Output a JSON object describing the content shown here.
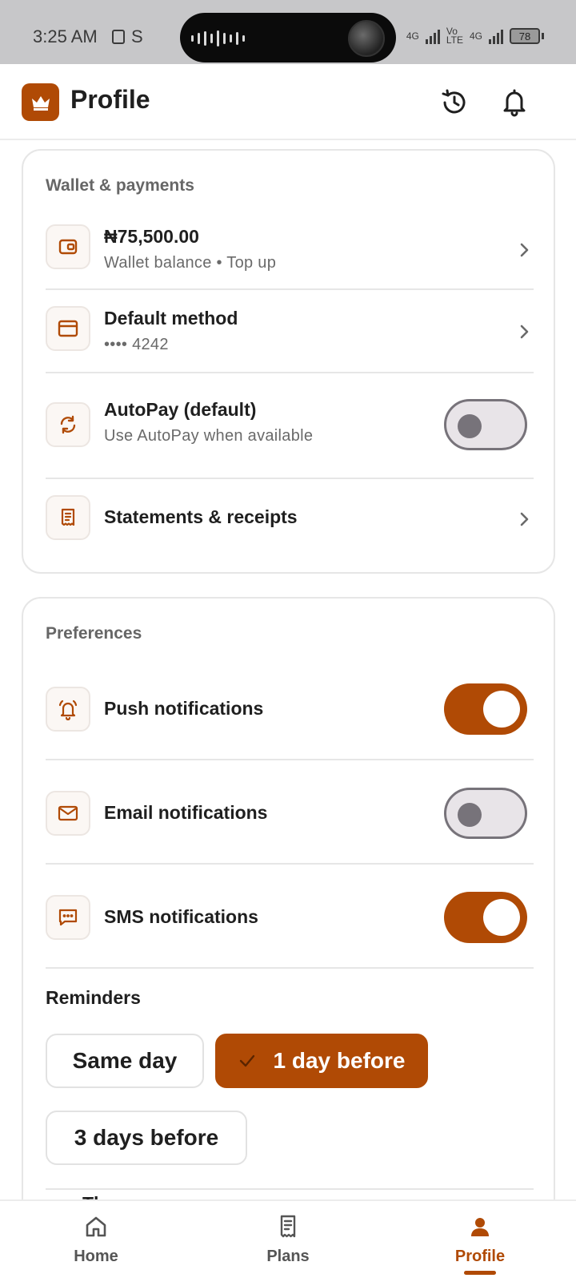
{
  "status_bar": {
    "time": "3:25 AM",
    "carrier_glyph": "S",
    "net1": "4G",
    "net2_top": "Vo",
    "net2_bottom": "LTE",
    "net3": "4G",
    "battery": "78"
  },
  "header": {
    "title": "Profile",
    "history_icon": "history-icon",
    "bell_icon": "bell-icon",
    "logo_icon": "crown-icon"
  },
  "wallet_card": {
    "title": "Wallet & payments",
    "balance": {
      "title": "₦75,500.00",
      "subtitle": "Wallet balance • Top up",
      "icon": "wallet-icon"
    },
    "default_method": {
      "title": "Default method",
      "subtitle": "•••• 4242",
      "icon": "card-icon"
    },
    "autopay": {
      "title": "AutoPay (default)",
      "subtitle": "Use AutoPay when available",
      "enabled": false,
      "icon": "refresh-icon"
    },
    "statements": {
      "title": "Statements & receipts",
      "icon": "receipt-icon"
    }
  },
  "preferences_card": {
    "title": "Preferences",
    "push": {
      "title": "Push notifications",
      "enabled": true,
      "icon": "bell-ring-icon"
    },
    "email": {
      "title": "Email notifications",
      "enabled": false,
      "icon": "mail-icon"
    },
    "sms": {
      "title": "SMS notifications",
      "enabled": true,
      "icon": "message-icon"
    },
    "reminders": {
      "label": "Reminders",
      "options": [
        "Same day",
        "1 day before",
        "3 days before"
      ],
      "selected": "1 day before"
    },
    "theme_label": "Theme"
  },
  "bottom_nav": {
    "items": [
      {
        "label": "Home",
        "icon": "home-icon",
        "active": false
      },
      {
        "label": "Plans",
        "icon": "receipt-icon",
        "active": false
      },
      {
        "label": "Profile",
        "icon": "person-icon",
        "active": true
      }
    ]
  },
  "colors": {
    "accent": "#b04a05",
    "toggle_off": "#77737a",
    "card_border": "#e6e6e6"
  }
}
